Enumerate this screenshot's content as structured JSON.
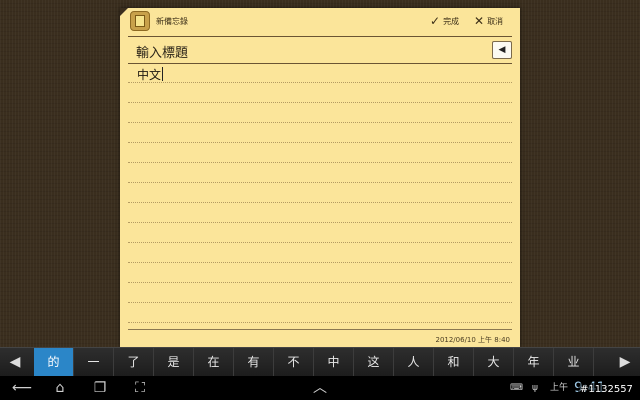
{
  "memo": {
    "title": "新備忘錄",
    "done_label": "完成",
    "cancel_label": "取消",
    "title_placeholder": "輸入標題",
    "body_text": "中文",
    "timestamp": "2012/06/10 上午 8:40",
    "icons": {
      "app": "memo-icon",
      "done": "check-icon",
      "cancel": "close-icon",
      "collapse": "triangle-left-icon"
    }
  },
  "ime": {
    "candidates": [
      "的",
      "一",
      "了",
      "是",
      "在",
      "有",
      "不",
      "中",
      "这",
      "人",
      "和",
      "大",
      "年",
      "业"
    ],
    "selected_index": 0,
    "icons": {
      "prev": "arrow-left-icon",
      "next": "arrow-right-icon"
    }
  },
  "system_bar": {
    "ampm": "上午",
    "time": "9:41",
    "watermark": "#1132557",
    "icons": [
      "back-icon",
      "home-icon",
      "recent-apps-icon",
      "screenshot-icon",
      "keyboard-up-icon",
      "keyboard-icon",
      "usb-icon"
    ]
  },
  "colors": {
    "note_bg": "#fbe59a",
    "selected_candidate": "#2b86c8",
    "background": "#3a2e1e"
  }
}
